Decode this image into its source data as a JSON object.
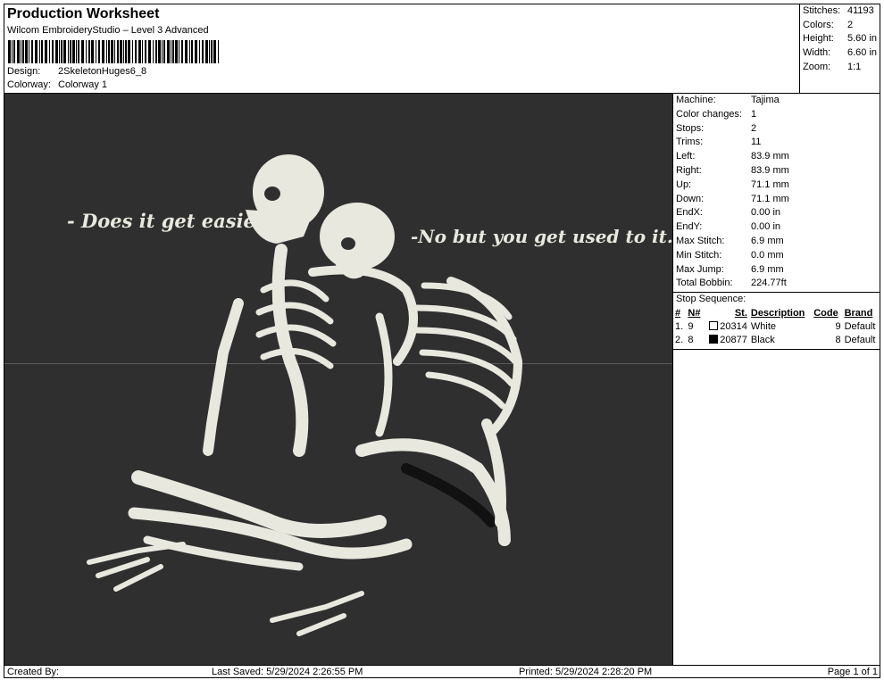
{
  "header": {
    "title": "Production Worksheet",
    "subtitle": "Wilcom EmbroideryStudio – Level 3 Advanced",
    "design_label": "Design:",
    "design_value": "2SkeletonHuges6_8",
    "colorway_label": "Colorway:",
    "colorway_value": "Colorway 1"
  },
  "summary": [
    {
      "label": "Stitches:",
      "value": "41193"
    },
    {
      "label": "Colors:",
      "value": "2"
    },
    {
      "label": "Height:",
      "value": "5.60 in"
    },
    {
      "label": "Width:",
      "value": "6.60 in"
    },
    {
      "label": "Zoom:",
      "value": "1:1"
    }
  ],
  "canvas": {
    "text_left": "- Does it get easier.",
    "text_right": "-No but you get used to it.",
    "background": "#2f2f2f",
    "thread_color": "#e8e8df"
  },
  "machine_info": [
    {
      "label": "Machine:",
      "value": "Tajima"
    },
    {
      "label": "Color changes:",
      "value": "1"
    },
    {
      "label": "Stops:",
      "value": "2"
    },
    {
      "label": "Trims:",
      "value": "11"
    },
    {
      "label": "Left:",
      "value": "83.9 mm"
    },
    {
      "label": "Right:",
      "value": "83.9 mm"
    },
    {
      "label": "Up:",
      "value": "71.1 mm"
    },
    {
      "label": "Down:",
      "value": "71.1 mm"
    },
    {
      "label": "EndX:",
      "value": "0.00 in"
    },
    {
      "label": "EndY:",
      "value": "0.00 in"
    },
    {
      "label": "Max Stitch:",
      "value": "6.9 mm"
    },
    {
      "label": "Min Stitch:",
      "value": "0.0 mm"
    },
    {
      "label": "Max Jump:",
      "value": "6.9 mm"
    },
    {
      "label": "Total Bobbin:",
      "value": "224.77ft"
    }
  ],
  "stop_sequence": {
    "title": "Stop Sequence:",
    "columns": [
      "#",
      "N#",
      "St.",
      "Description",
      "Code",
      "Brand"
    ],
    "rows": [
      {
        "num": "1.",
        "n": "9",
        "swatch": "#ffffff",
        "st": "20314",
        "description": "White",
        "code": "9",
        "brand": "Default"
      },
      {
        "num": "2.",
        "n": "8",
        "swatch": "#000000",
        "st": "20877",
        "description": "Black",
        "code": "8",
        "brand": "Default"
      }
    ]
  },
  "footer": {
    "created_by": "Created By:",
    "last_saved": "Last Saved: 5/29/2024 2:26:55 PM",
    "printed": "Printed: 5/29/2024 2:28:20 PM",
    "page": "Page 1 of 1"
  }
}
